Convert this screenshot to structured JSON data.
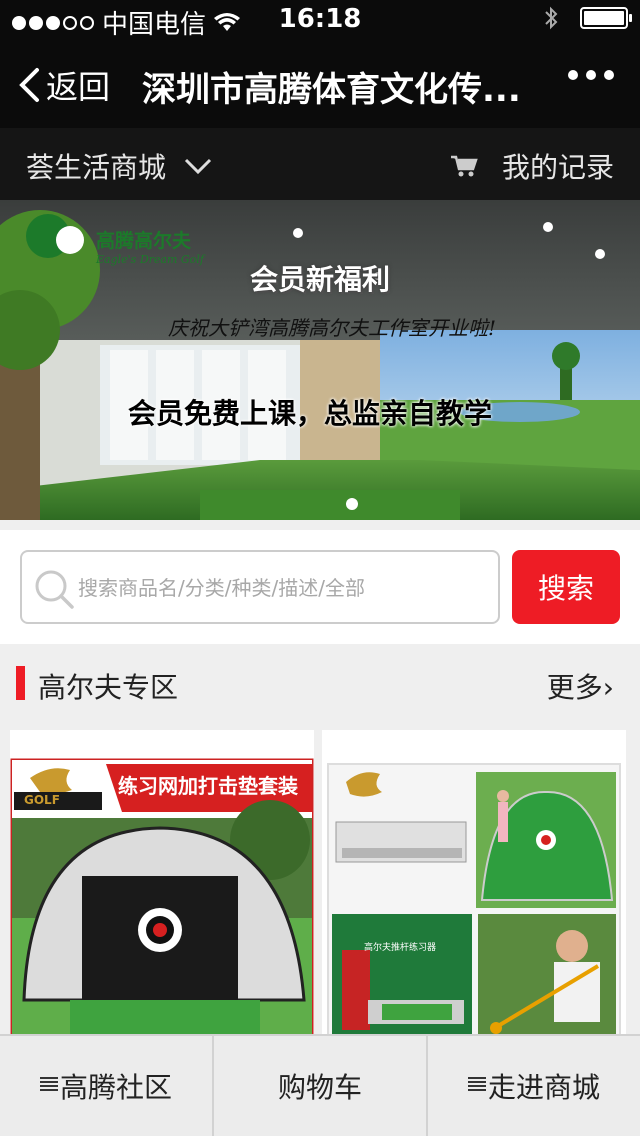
{
  "status": {
    "carrier": "中国电信",
    "time": "16:18",
    "signal_filled": 3,
    "signal_total": 5,
    "battery_level": 1.0
  },
  "nav": {
    "back_label": "返回",
    "title": "深圳市高腾体育文化传..."
  },
  "subnav": {
    "store_label": "荟生活商城",
    "records_label": "我的记录"
  },
  "banner": {
    "logo_cn": "高腾高尔夫",
    "logo_en": "Eagle's Dream Golf",
    "headline": "会员新福利",
    "subline": "庆祝大铲湾高腾高尔夫工作室开业啦!",
    "main_text": "会员免费上课，总监亲自教学"
  },
  "search": {
    "placeholder": "搜索商品名/分类/种类/描述/全部",
    "button_label": "搜索"
  },
  "section": {
    "title": "高尔夫专区",
    "more_label": "更多›"
  },
  "products": [
    {
      "title": "练习网加打击垫套装",
      "brand": "GOLF"
    },
    {
      "label": "高尔夫推杆练习器"
    }
  ],
  "tabbar": {
    "items": [
      {
        "label": "高腾社区"
      },
      {
        "label": "购物车"
      },
      {
        "label": "走进商城"
      }
    ]
  },
  "colors": {
    "accent": "#ee1c25",
    "bar_bg": "#0b0b0b",
    "golf_green": "#2e8b2e"
  }
}
